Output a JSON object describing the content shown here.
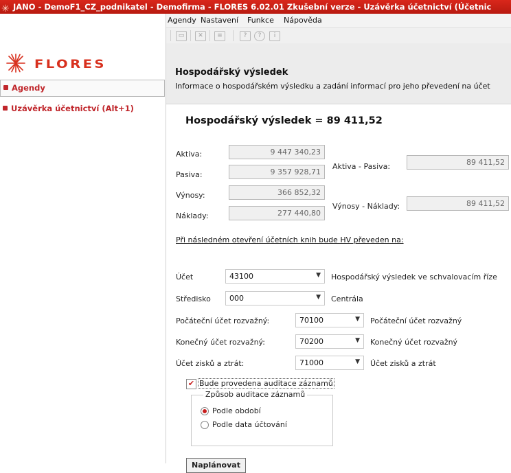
{
  "window": {
    "title": "JANO - DemoF1_CZ_podnikatel - Demofirma - FLORES 6.02.01 Zkušební verze - Uzávěrka účetnictví (Účetnic"
  },
  "brand": {
    "logo_text": "FLORES",
    "accent": "#d8301e"
  },
  "sidebar": {
    "items": [
      {
        "label": "Agendy"
      },
      {
        "label": "Uzávěrka účetnictví (Alt+1)"
      }
    ]
  },
  "menu": {
    "items": [
      {
        "label": "Agendy"
      },
      {
        "label": "Nastavení"
      },
      {
        "label": "Funkce"
      },
      {
        "label": "Nápověda"
      }
    ]
  },
  "toolbar": {
    "icons": [
      "folder-open-icon",
      "close-doc-icon",
      "list-icon",
      "doc-icon",
      "help-icon",
      "info-icon"
    ]
  },
  "header": {
    "title": "Hospodářský výsledek",
    "subtitle": "Informace o hospodářském výsledku a zadání informací pro jeho převedení na účet"
  },
  "main": {
    "hv_heading": "Hospodářský výsledek = 89 411,52",
    "aktiva_label": "Aktiva:",
    "aktiva_value": "9 447 340,23",
    "pasiva_label": "Pasiva:",
    "pasiva_value": "9 357 928,71",
    "aktiva_pasiva_label": "Aktiva - Pasiva:",
    "aktiva_pasiva_value": "89 411,52",
    "vynosy_label": "Výnosy:",
    "vynosy_value": "366 852,32",
    "naklady_label": "Náklady:",
    "naklady_value": "277 440,80",
    "vynosy_naklady_label": "Výnosy - Náklady:",
    "vynosy_naklady_value": "89 411,52",
    "transfer_note": "Při následném otevření účetních knih bude HV převeden na:",
    "ucet_label": "Účet",
    "ucet_value": "43100",
    "ucet_desc": "Hospodářský výsledek ve schvalovacím říze",
    "stredisko_label": "Středisko",
    "stredisko_value": "000",
    "stredisko_desc": "Centrála",
    "pocatecni_label": "Počáteční účet rozvažný:",
    "pocatecni_value": "70100",
    "pocatecni_desc": "Počáteční účet rozvažný",
    "konecny_label": "Konečný účet rozvažný:",
    "konecny_value": "70200",
    "konecny_desc": "Konečný účet rozvažný",
    "zisku_label": "Účet zisků a ztrát:",
    "zisku_value": "71000",
    "zisku_desc": "Účet zisků a ztrát",
    "audit_checkbox_label": "Bude provedena auditace záznamů",
    "audit_checked": true,
    "audit_group_title": "Způsob auditace záznamů",
    "audit_options": [
      {
        "label": "Podle období",
        "selected": true
      },
      {
        "label": "Podle data účtování",
        "selected": false
      }
    ],
    "schedule_button": "Naplánovat"
  }
}
